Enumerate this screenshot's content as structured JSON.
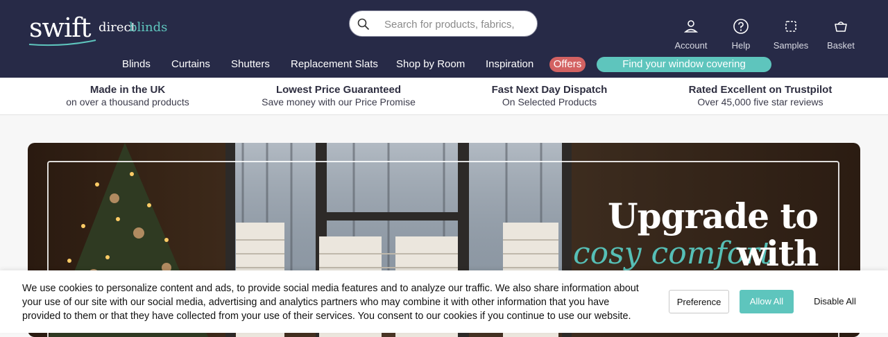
{
  "logo": {
    "swift": "swift",
    "direct": "direct",
    "blinds": "blinds"
  },
  "search": {
    "placeholder": "Search for products, fabrics,"
  },
  "utility": [
    {
      "label": "Account",
      "icon": "user-icon"
    },
    {
      "label": "Help",
      "icon": "help-icon"
    },
    {
      "label": "Samples",
      "icon": "samples-icon"
    },
    {
      "label": "Basket",
      "icon": "basket-icon"
    }
  ],
  "nav": {
    "items": [
      "Blinds",
      "Curtains",
      "Shutters",
      "Replacement Slats",
      "Shop by Room",
      "Inspiration"
    ],
    "offers": "Offers",
    "find": "Find your window covering"
  },
  "usps": [
    {
      "title": "Made in the UK",
      "subtitle": "on over a thousand products"
    },
    {
      "title": "Lowest Price Guaranteed",
      "subtitle": "Save money with our Price Promise"
    },
    {
      "title": "Fast Next Day Dispatch",
      "subtitle": "On Selected Products"
    },
    {
      "title": "Rated Excellent on Trustpilot",
      "subtitle": "Over 45,000 five star reviews"
    }
  ],
  "hero": {
    "line1": "Upgrade to",
    "accent": "cosy comfort",
    "line2": "with"
  },
  "cookie": {
    "text": "We use cookies to personalize content and ads, to provide social media features and to analyze our traffic. We also share information about your use of our site with our social media, advertising and analytics partners who may combine it with other information that you have provided to them or that they have collected from your use of their services. You consent to our cookies if you continue to use our website.",
    "preference": "Preference",
    "allow_all": "Allow All",
    "disable_all": "Disable All"
  },
  "colors": {
    "header": "#272a47",
    "accent": "#5ec5bd",
    "offers": "#d36262"
  }
}
